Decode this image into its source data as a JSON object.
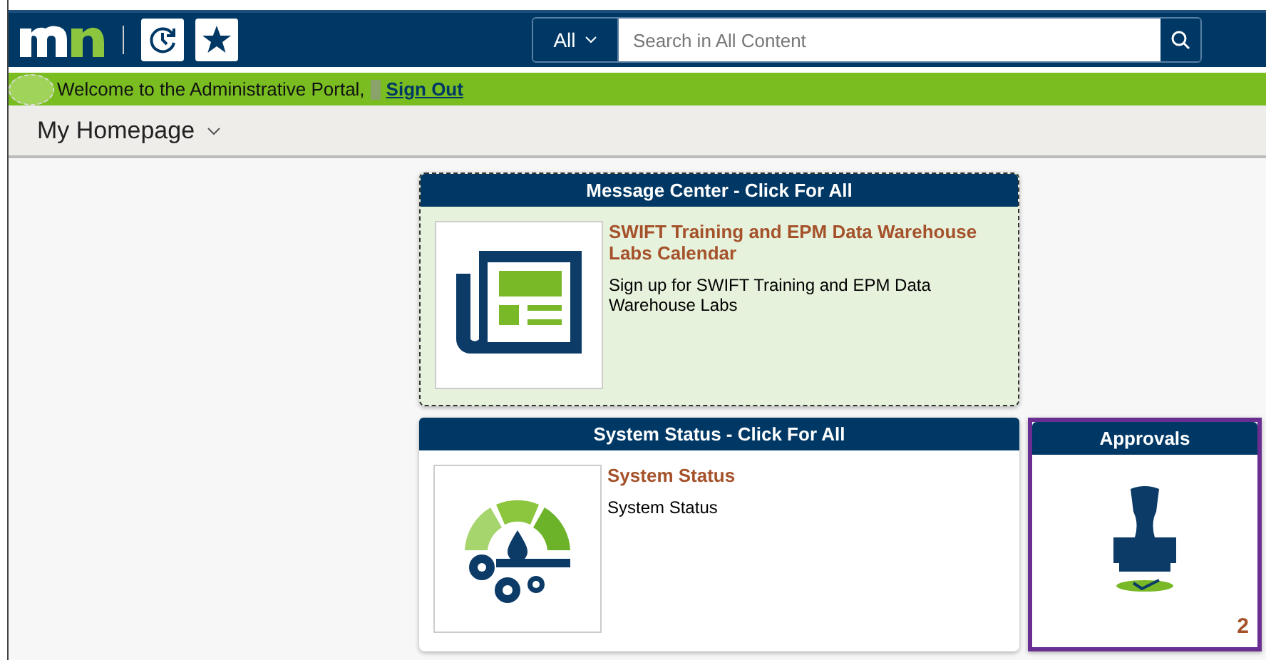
{
  "header": {
    "search": {
      "scope": "All",
      "placeholder": "Search in All Content"
    }
  },
  "welcome": {
    "text": "Welcome to the Administrative Portal,",
    "link": "Sign Out"
  },
  "page_title": "My Homepage",
  "tiles": [
    {
      "kind": "message",
      "title": "Message Center - Click For All",
      "heading": "SWIFT Training and EPM Data Warehouse Labs Calendar",
      "body": "Sign up for SWIFT Training and EPM Data Warehouse Labs",
      "focused": true,
      "selected": false
    },
    {
      "kind": "status",
      "title": "System Status - Click For All",
      "heading": "System Status",
      "body": "System Status",
      "focused": false,
      "selected": false
    },
    {
      "kind": "approvals",
      "title": "Approvals",
      "count": "2",
      "focused": false,
      "selected": true
    }
  ]
}
